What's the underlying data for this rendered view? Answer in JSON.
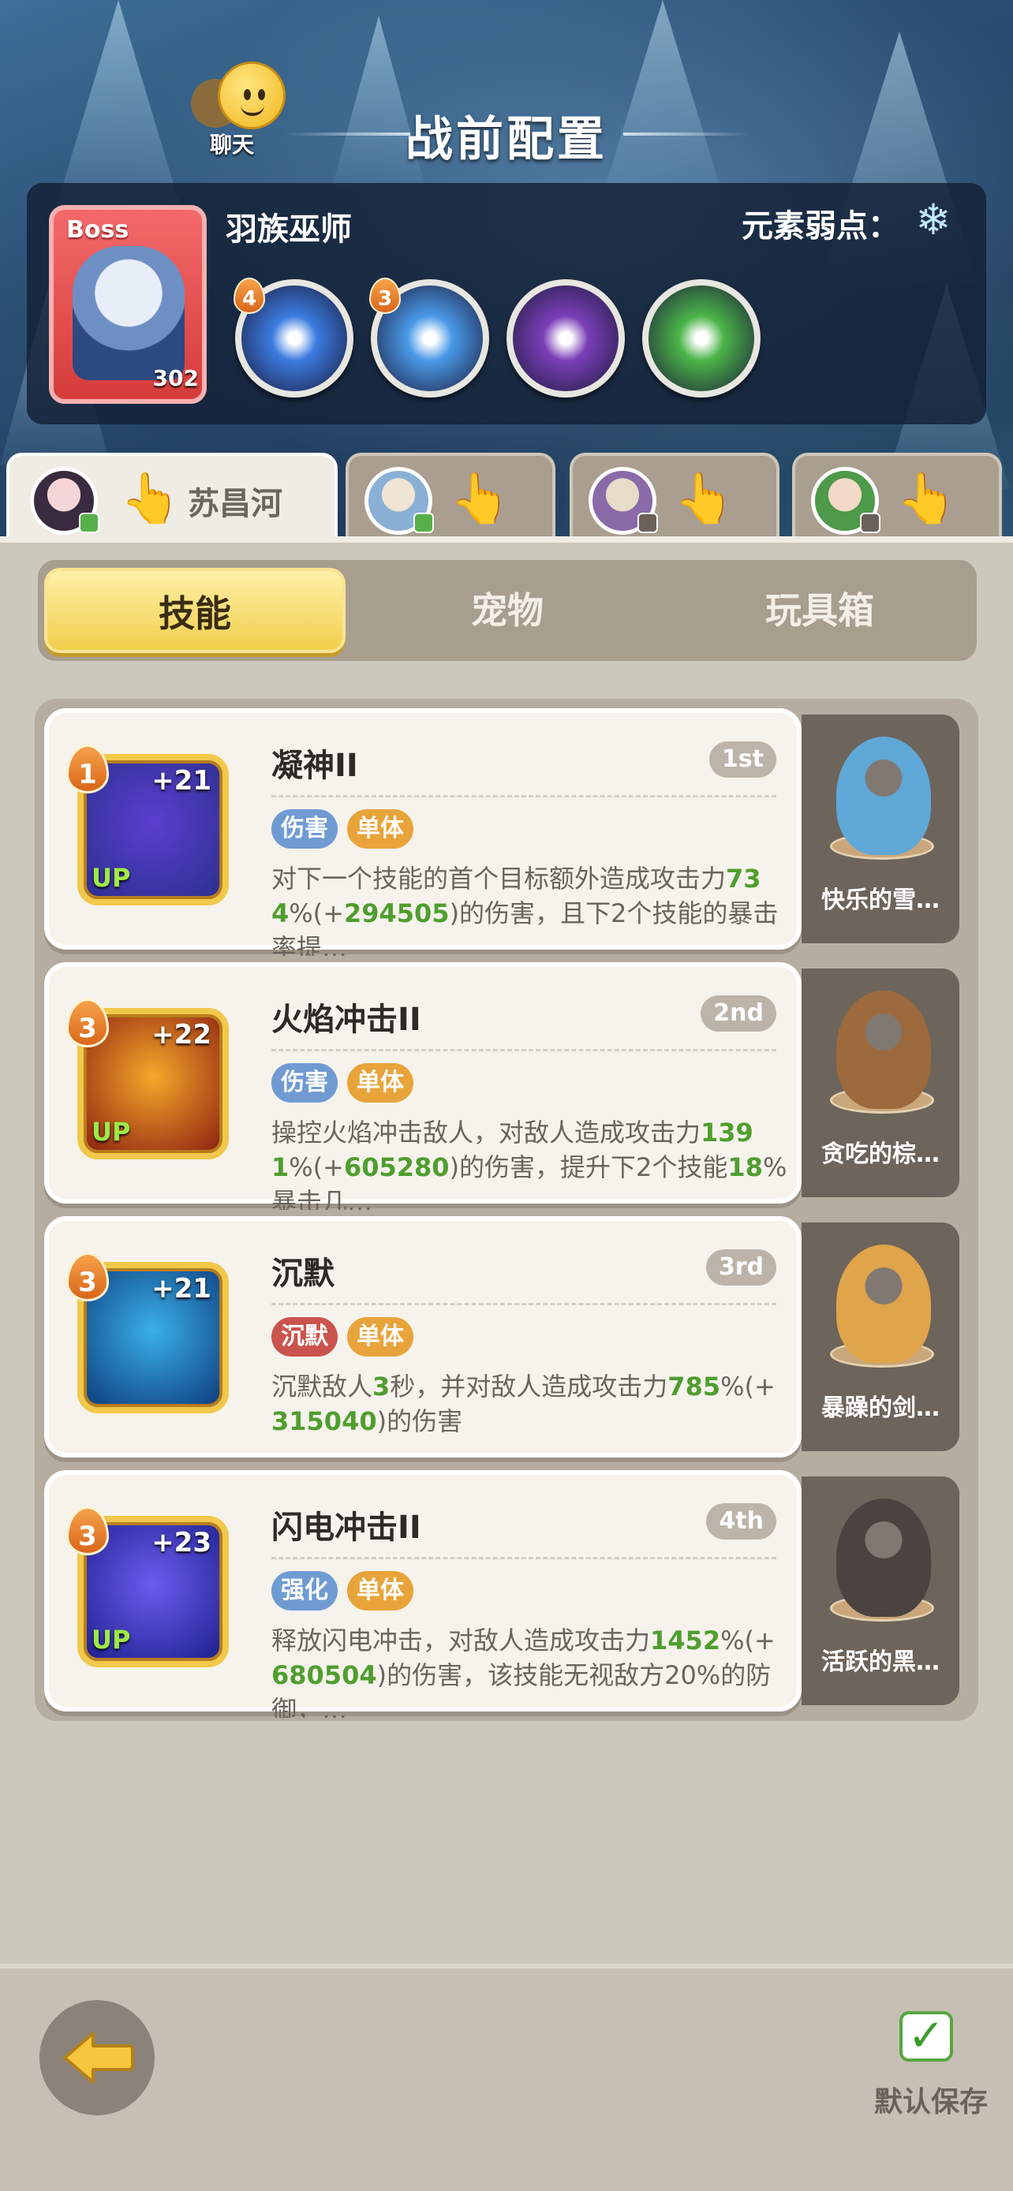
{
  "header": {
    "chat_label": "聊天",
    "title": "战前配置"
  },
  "boss": {
    "tag": "Boss",
    "level": "302",
    "name": "羽族巫师",
    "weakness_label": "元素弱点：",
    "weakness_icon": "snowflake-icon",
    "orbs": [
      {
        "count": "4",
        "color": "#3b7be0"
      },
      {
        "count": "3",
        "color": "#4a9ae8"
      },
      {
        "count": "",
        "color": "#7a3fb8"
      },
      {
        "count": "",
        "color": "#4bb548"
      }
    ]
  },
  "players": [
    {
      "name": "苏昌河",
      "active": true
    },
    {
      "name": "",
      "active": false
    },
    {
      "name": "",
      "active": false
    },
    {
      "name": "",
      "active": false
    }
  ],
  "segment": {
    "tabs": [
      "技能",
      "宠物",
      "玩具箱"
    ],
    "active_index": 0
  },
  "skills": [
    {
      "level": "1",
      "plus": "+21",
      "up": "UP",
      "title": "凝神II",
      "order": "1st",
      "tags": [
        {
          "label": "伤害",
          "color": "blue"
        },
        {
          "label": "单体",
          "color": "orange"
        }
      ],
      "desc_parts": [
        "对下一个技能的首个目标额外造成攻击力",
        "734",
        "%(+",
        "294505",
        ")的伤害，且下2个技能的暴击率提…"
      ],
      "icon_colors": [
        "#2b2f8c",
        "#5a3fd0"
      ],
      "pet_name": "快乐的雪…",
      "pet_color": "#5fa8d8"
    },
    {
      "level": "3",
      "plus": "+22",
      "up": "UP",
      "title": "火焰冲击II",
      "order": "2nd",
      "tags": [
        {
          "label": "伤害",
          "color": "blue"
        },
        {
          "label": "单体",
          "color": "orange"
        }
      ],
      "desc_parts": [
        "操控火焰冲击敌人，对敌人造成攻击力",
        "1391",
        "%(+",
        "605280",
        ")的伤害，提升下2个技能",
        "18",
        "%暴击几…"
      ],
      "icon_colors": [
        "#8a1e10",
        "#f7a72a"
      ],
      "pet_name": "贪吃的棕…",
      "pet_color": "#9c6a3c"
    },
    {
      "level": "3",
      "plus": "+21",
      "up": "",
      "title": "沉默",
      "order": "3rd",
      "tags": [
        {
          "label": "沉默",
          "color": "red"
        },
        {
          "label": "单体",
          "color": "orange"
        }
      ],
      "desc_parts": [
        "沉默敌人",
        "3",
        "秒，并对敌人造成攻击力",
        "785",
        "%(+",
        "315040",
        ")的伤害"
      ],
      "icon_colors": [
        "#0d3a7a",
        "#39b0e8"
      ],
      "pet_name": "暴躁的剑…",
      "pet_color": "#e0a44a"
    },
    {
      "level": "3",
      "plus": "+23",
      "up": "UP",
      "title": "闪电冲击II",
      "order": "4th",
      "tags": [
        {
          "label": "强化",
          "color": "blue"
        },
        {
          "label": "单体",
          "color": "orange"
        }
      ],
      "desc_parts": [
        "释放闪电冲击，对敌人造成攻击力",
        "1452",
        "%(+",
        "680504",
        ")的伤害，该技能无视敌方20%的防御，…"
      ],
      "icon_colors": [
        "#1c1f8a",
        "#6a5cf0"
      ],
      "pet_name": "活跃的黑…",
      "pet_color": "#4a4340"
    }
  ],
  "bottom": {
    "save_label": "默认保存"
  }
}
